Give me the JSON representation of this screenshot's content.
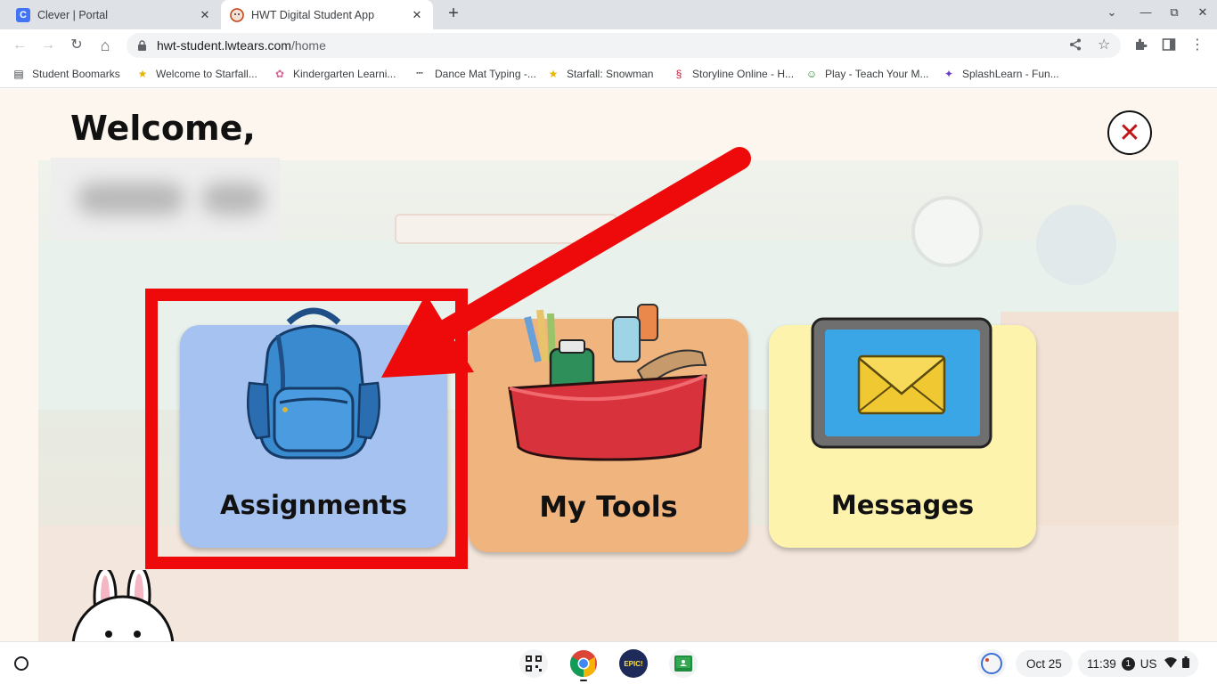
{
  "browser": {
    "tabs": [
      {
        "title": "Clever | Portal",
        "favicon": "clever-favicon",
        "favicon_letter": "C",
        "active": false
      },
      {
        "title": "HWT Digital Student App",
        "favicon": "hwt-favicon",
        "active": true
      }
    ],
    "tab_close_glyph": "✕",
    "new_tab_glyph": "+",
    "window_controls": [
      "⌄",
      "—",
      "⧉",
      "✕"
    ],
    "nav": {
      "back": "←",
      "forward": "→",
      "reload": "↻",
      "home": "⌂"
    },
    "url": {
      "host": "hwt-student.lwtears.com",
      "path": "/home"
    },
    "bookmarks": [
      {
        "label": "Student Boomarks",
        "icon": "folder-icon",
        "glyph": "▤"
      },
      {
        "label": "Welcome to Starfall...",
        "icon": "starfall-icon",
        "glyph": "★"
      },
      {
        "label": "Kindergarten Learni...",
        "icon": "palette-icon",
        "glyph": "✿"
      },
      {
        "label": "Dance Mat Typing -...",
        "icon": "dots-icon",
        "glyph": "▪▪▪"
      },
      {
        "label": "Starfall: Snowman",
        "icon": "starfall-icon",
        "glyph": "★"
      },
      {
        "label": "Storyline Online - H...",
        "icon": "storyline-icon",
        "glyph": "§"
      },
      {
        "label": "Play - Teach Your M...",
        "icon": "monster-icon",
        "glyph": "☺"
      },
      {
        "label": "SplashLearn - Fun...",
        "icon": "splashlearn-icon",
        "glyph": "✦"
      }
    ]
  },
  "page": {
    "welcome": "Welcome,",
    "close_glyph": "✕",
    "cards": [
      {
        "label": "Assignments",
        "icon": "backpack-icon"
      },
      {
        "label": "My Tools",
        "icon": "toolbox-icon"
      },
      {
        "label": "Messages",
        "icon": "envelope-tablet-icon"
      }
    ]
  },
  "colors": {
    "highlight": "#ee0a0a",
    "assignments_card": "#a6c2f0",
    "tools_card": "#f0b57e",
    "messages_card": "#fdf3ad"
  },
  "shelf": {
    "apps": [
      "qr-code-icon",
      "chrome-icon",
      "epic-icon",
      "google-classroom-icon"
    ],
    "epic_text": "EPIC!",
    "date": "Oct 25",
    "time": "11:39",
    "notification_count": "1",
    "keyboard": "US"
  }
}
